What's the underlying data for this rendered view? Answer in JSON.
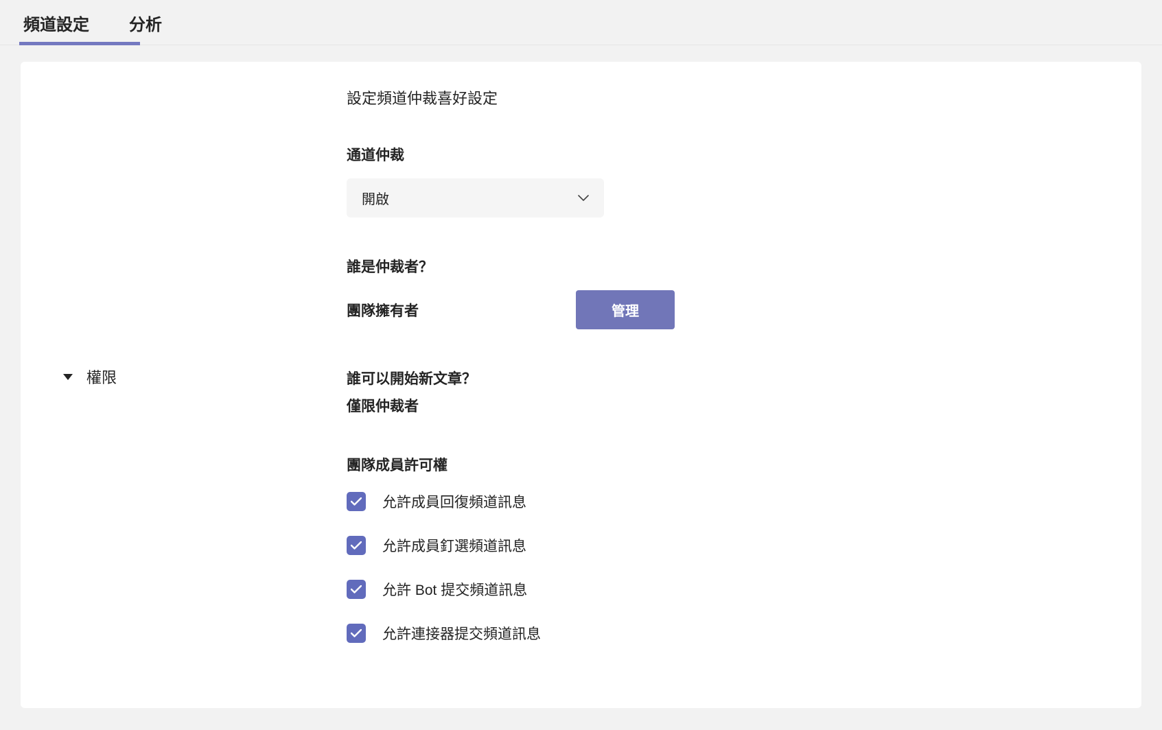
{
  "tabs": {
    "settings": "頻道設定",
    "analytics": "分析"
  },
  "section": {
    "title": "權限",
    "description": "設定頻道仲裁喜好設定"
  },
  "moderation": {
    "label": "通道仲裁",
    "value": "開啟"
  },
  "moderators": {
    "label": "誰是仲裁者？",
    "value": "團隊擁有者",
    "manage_btn": "管理"
  },
  "newposts": {
    "label": "誰可以開始新文章？",
    "value": "僅限仲裁者"
  },
  "member_permissions": {
    "heading": "團隊成員許可權",
    "items": [
      {
        "label": "允許成員回復頻道訊息"
      },
      {
        "label": "允許成員釘選頻道訊息"
      },
      {
        "label": "允許 Bot 提交頻道訊息"
      },
      {
        "label": "允許連接器提交頻道訊息"
      }
    ]
  }
}
